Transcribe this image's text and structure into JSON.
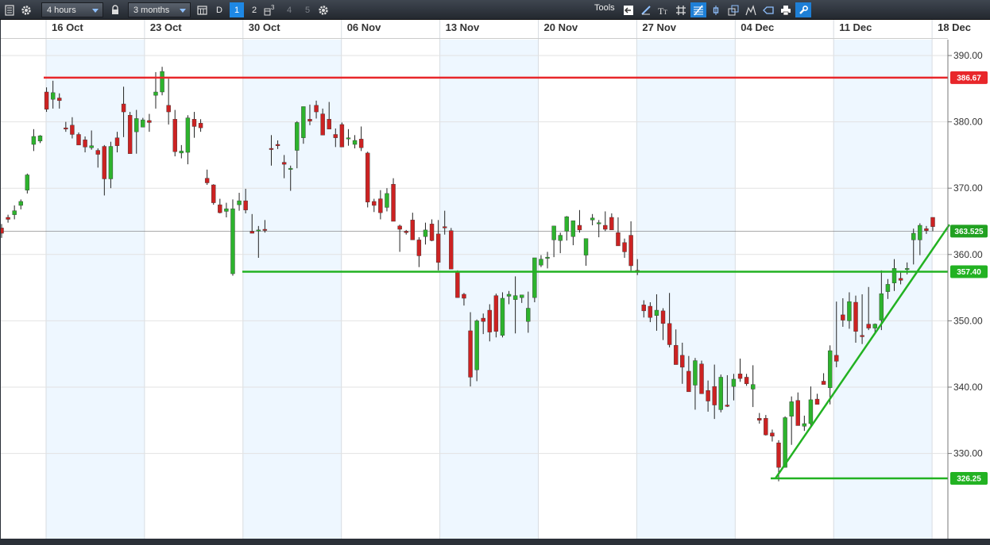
{
  "toolbar": {
    "interval": "4 hours",
    "range": "3 months",
    "period_d": "D",
    "layouts": [
      "1",
      "2",
      "3",
      "4",
      "5"
    ],
    "tools_label": "Tools",
    "accent": "#1e88e5"
  },
  "chart_data": {
    "type": "candlestick",
    "date_labels": [
      "16 Oct",
      "23 Oct",
      "30 Oct",
      "06 Nov",
      "13 Nov",
      "20 Nov",
      "27 Nov",
      "04 Dec",
      "11 Dec",
      "18 Dec"
    ],
    "price_ticks": [
      "390.00",
      "380.00",
      "370.00",
      "360.00",
      "350.00",
      "340.00",
      "330.00"
    ],
    "ylim": [
      322,
      393
    ],
    "current_price": "363.525",
    "up_color": "#2db32d",
    "down_color": "#cc2222",
    "horizontal_lines": [
      {
        "label": "386.67",
        "value": 386.67,
        "color": "#e8262a"
      },
      {
        "label": "357.40",
        "value": 357.4,
        "color": "#22b222"
      },
      {
        "label": "326.25",
        "value": 326.25,
        "color": "#22b222"
      }
    ],
    "trendlines": [
      {
        "from": [
          324.8,
          326.25
        ],
        "to": [
          328.4,
          364.5
        ],
        "color": "#22b222"
      }
    ],
    "candles": [
      [
        364,
        364.6,
        362.5,
        363.2
      ],
      [
        365.6,
        366,
        364.8,
        365.3
      ],
      [
        366,
        367.4,
        365.3,
        366.6
      ],
      [
        367.4,
        368.3,
        366.8,
        368
      ],
      [
        369.7,
        372.2,
        369.2,
        372
      ],
      [
        376.6,
        378.9,
        375.6,
        377.8
      ],
      [
        377.1,
        378,
        376.8,
        377.9
      ],
      [
        384.5,
        385.2,
        381.5,
        381.9
      ],
      [
        383.4,
        386.2,
        382,
        384.4
      ],
      [
        383.6,
        384.3,
        382,
        383.2
      ],
      [
        379.1,
        380,
        378.5,
        378.9
      ],
      [
        379.5,
        380.7,
        377.5,
        378.1
      ],
      [
        378.1,
        378.4,
        376.5,
        376.5
      ],
      [
        377.3,
        377.8,
        375.4,
        376.2
      ],
      [
        376.1,
        378.7,
        375.8,
        376.4
      ],
      [
        375.7,
        376,
        373.1,
        375.1
      ],
      [
        376.3,
        376.5,
        368.9,
        371.4
      ],
      [
        371.4,
        377,
        370,
        376.3
      ],
      [
        377.6,
        378.5,
        375.4,
        376.4
      ],
      [
        382.7,
        385.3,
        377.7,
        381.5
      ],
      [
        381,
        381.5,
        375.5,
        375.2
      ],
      [
        378.5,
        381.8,
        375.2,
        380.5
      ],
      [
        379.2,
        380.6,
        379.2,
        380.3
      ],
      [
        380.2,
        381.2,
        378.5,
        379.9
      ],
      [
        384,
        387.5,
        382,
        384.5
      ],
      [
        384.5,
        388.3,
        384,
        387.6
      ],
      [
        382.5,
        386.5,
        379.6,
        381.5
      ],
      [
        380.4,
        381.8,
        374.8,
        375.5
      ],
      [
        375.3,
        376.5,
        374.5,
        375.6
      ],
      [
        375.4,
        381,
        373.6,
        380.6
      ],
      [
        380.4,
        381.5,
        377.6,
        379.3
      ],
      [
        379.8,
        380.4,
        378.5,
        379.1
      ],
      [
        371.5,
        372.8,
        370.5,
        370.8
      ],
      [
        370.5,
        370.6,
        367.5,
        367.8
      ],
      [
        367.5,
        368.4,
        366.2,
        366.3
      ],
      [
        366.5,
        367.8,
        365.6,
        366.9
      ],
      [
        357.1,
        368.3,
        356.8,
        366.9
      ],
      [
        367.5,
        369.3,
        366.6,
        368.1
      ],
      [
        368.1,
        369.9,
        366.2,
        366.7
      ],
      [
        363.5,
        366.1,
        363.2,
        363.2
      ],
      [
        363.7,
        364.3,
        359.5,
        363.7
      ],
      [
        363.8,
        365.2,
        363.3,
        363.7
      ],
      [
        376,
        378,
        373.4,
        375.9
      ],
      [
        376.6,
        377.2,
        375.9,
        376.4
      ],
      [
        373.9,
        375,
        371.5,
        373.6
      ],
      [
        372.9,
        373.4,
        369.6,
        373
      ],
      [
        375.7,
        380.1,
        373,
        379.9
      ],
      [
        377.6,
        381.3,
        376.7,
        382.3
      ],
      [
        380.4,
        382.6,
        379.5,
        380.1
      ],
      [
        382.5,
        383.2,
        380.5,
        381.5
      ],
      [
        381.2,
        382,
        379.5,
        378
      ],
      [
        380.4,
        383,
        379,
        378.9
      ],
      [
        378.1,
        379,
        376.2,
        377.6
      ],
      [
        379.6,
        379.9,
        376.6,
        376.2
      ],
      [
        377.5,
        378.9,
        376.4,
        377.6
      ],
      [
        376.6,
        378,
        376,
        377.2
      ],
      [
        377.4,
        379.3,
        375.6,
        376.1
      ],
      [
        375.3,
        375.5,
        367.1,
        367.9
      ],
      [
        368,
        368.4,
        366.4,
        367.4
      ],
      [
        368.4,
        369.7,
        365.3,
        366.3
      ],
      [
        367.1,
        370,
        366.5,
        369.2
      ],
      [
        370.6,
        371.5,
        366.6,
        365
      ],
      [
        364.3,
        364.5,
        360.4,
        363.8
      ],
      [
        363.5,
        363.7,
        363,
        363.3
      ],
      [
        365.2,
        366.3,
        362.2,
        362.2
      ],
      [
        362.2,
        362.6,
        358.1,
        359.8
      ],
      [
        362.7,
        364.8,
        361.5,
        363.7
      ],
      [
        364.6,
        365.3,
        362,
        362.1
      ],
      [
        363.1,
        365.2,
        357.6,
        358.8
      ],
      [
        364.2,
        366.6,
        363,
        364
      ],
      [
        363.6,
        364,
        359,
        357.8
      ],
      [
        357.4,
        357.6,
        355,
        353.5
      ],
      [
        354,
        354.2,
        352.3,
        353.4
      ],
      [
        348.5,
        351.3,
        340.1,
        341.5
      ],
      [
        342.6,
        350.2,
        340.9,
        350
      ],
      [
        350.4,
        351.1,
        348,
        349.9
      ],
      [
        351.6,
        352.5,
        346.9,
        348.3
      ],
      [
        353.8,
        354.1,
        347.5,
        348.4
      ],
      [
        347.8,
        354.3,
        347.5,
        353.4
      ],
      [
        353.7,
        354.5,
        352.5,
        354
      ],
      [
        353.2,
        356.7,
        348.1,
        353.8
      ],
      [
        353.5,
        353.8,
        352.7,
        353.9
      ],
      [
        349.9,
        354.4,
        348.2,
        351.9
      ],
      [
        353.5,
        359.5,
        352.8,
        359.5
      ],
      [
        358.4,
        359.9,
        358.1,
        359.3
      ],
      [
        359.5,
        360.4,
        357.9,
        359.6
      ],
      [
        362.2,
        361.7,
        359.6,
        364.3
      ],
      [
        362.1,
        363.3,
        360.2,
        362.9
      ],
      [
        363.5,
        365.8,
        362.1,
        365.7
      ],
      [
        362.7,
        364.7,
        361.4,
        365.1
      ],
      [
        364.4,
        366.7,
        363.3,
        363.7
      ],
      [
        359.9,
        361.9,
        358.3,
        362.4
      ],
      [
        365.2,
        366.1,
        364.4,
        365.5
      ],
      [
        364.8,
        365.2,
        362.6,
        364.8
      ],
      [
        364.4,
        366.5,
        363.5,
        363.8
      ],
      [
        365.6,
        366.2,
        363.8,
        363.7
      ],
      [
        363.3,
        365.6,
        361.8,
        361.3
      ],
      [
        361.8,
        362.4,
        359.5,
        360.4
      ],
      [
        362.9,
        365,
        357.3,
        358.3
      ],
      [
        357.6,
        359.3,
        356.9,
        357.3
      ],
      [
        352.4,
        353.1,
        350.5,
        351.5
      ],
      [
        352.2,
        352.8,
        349.8,
        350.5
      ],
      [
        350.8,
        354,
        348.5,
        351.6
      ],
      [
        351.5,
        351.9,
        347.1,
        349.6
      ],
      [
        349.6,
        354.2,
        346,
        346.4
      ],
      [
        346.3,
        348.7,
        344.5,
        343.4
      ],
      [
        344.8,
        346.7,
        340.5,
        343
      ],
      [
        342.4,
        344.7,
        339.6,
        339.3
      ],
      [
        340.3,
        344.4,
        336.6,
        344
      ],
      [
        343.5,
        344,
        342.5,
        339
      ],
      [
        339.5,
        341,
        336.3,
        337.9
      ],
      [
        340.1,
        343.4,
        335.2,
        337.3
      ],
      [
        336.6,
        341.9,
        336.2,
        341.5
      ],
      [
        337.3,
        341.8,
        337,
        337.1
      ],
      [
        340.1,
        342,
        338,
        341.2
      ],
      [
        342,
        344.3,
        340.8,
        341.3
      ],
      [
        341.5,
        342,
        340.2,
        340.5
      ],
      [
        339.7,
        343.3,
        337,
        340.4
      ],
      [
        335.3,
        336.1,
        334.5,
        335
      ],
      [
        335.3,
        335.8,
        332.7,
        332.8
      ],
      [
        333.1,
        333.6,
        331.8,
        332.6
      ],
      [
        331.6,
        332,
        325.8,
        327.9
      ],
      [
        327.9,
        335.6,
        330,
        335.4
      ],
      [
        335.6,
        338.6,
        331.3,
        337.8
      ],
      [
        338,
        339.2,
        335.7,
        334.2
      ],
      [
        334.1,
        335.7,
        333.4,
        334.5
      ],
      [
        334.5,
        340.1,
        333.9,
        338.1
      ],
      [
        338.2,
        339,
        337.7,
        337.4
      ],
      [
        340.9,
        342.1,
        340.6,
        340.4
      ],
      [
        339.9,
        346.3,
        337.4,
        345.5
      ],
      [
        344.8,
        352.9,
        343,
        343.9
      ],
      [
        350.9,
        353.4,
        349.1,
        350.1
      ],
      [
        350,
        354.3,
        348.8,
        352.9
      ],
      [
        352.8,
        353.8,
        346.7,
        348.4
      ],
      [
        347.8,
        354,
        346.5,
        347.6
      ],
      [
        349.5,
        355.1,
        348.6,
        348.9
      ],
      [
        348.9,
        349.6,
        348,
        349.5
      ],
      [
        350.1,
        357.6,
        348.6,
        354.1
      ],
      [
        354.4,
        356.3,
        353.3,
        355.5
      ],
      [
        355.7,
        359.3,
        354.5,
        357.9
      ],
      [
        356.4,
        357.4,
        355.5,
        356.1
      ],
      [
        357.8,
        358.8,
        357,
        357.9
      ],
      [
        362.2,
        363.9,
        358.5,
        363.2
      ],
      [
        362.2,
        364.7,
        359.9,
        364.4
      ],
      [
        363.9,
        364.3,
        363.1,
        363.6
      ],
      [
        365.6,
        365.4,
        363.5,
        364.2
      ]
    ]
  }
}
